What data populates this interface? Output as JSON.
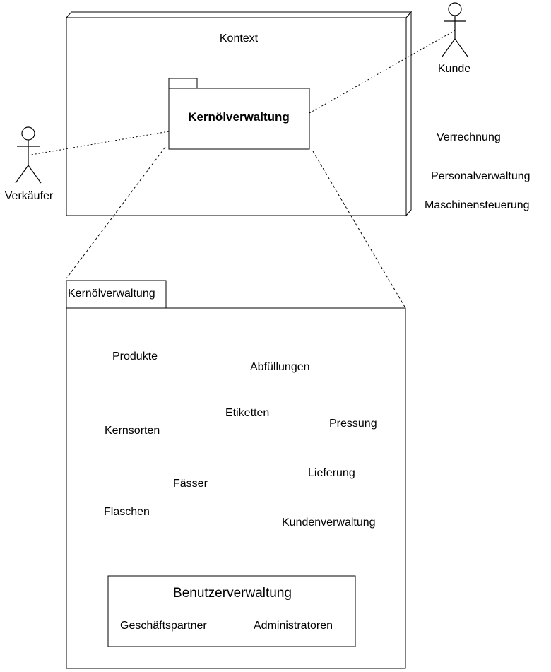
{
  "context": {
    "title": "Kontext",
    "core_package": "Kernölverwaltung"
  },
  "actors": {
    "customer": "Kunde",
    "seller": "Verkäufer"
  },
  "external_systems": [
    "Verrechnung",
    "Personalverwaltung",
    "Maschinensteuerung"
  ],
  "detail_package": {
    "tab_label": "Kernölverwaltung",
    "items": [
      "Produkte",
      "Abfüllungen",
      "Etiketten",
      "Kernsorten",
      "Pressung",
      "Lieferung",
      "Fässer",
      "Flaschen",
      "Kundenverwaltung"
    ],
    "user_management": {
      "title": "Benutzerverwaltung",
      "items": [
        "Geschäftspartner",
        "Administratoren"
      ]
    }
  },
  "colors": {
    "line": "#000000",
    "background": "#ffffff"
  }
}
